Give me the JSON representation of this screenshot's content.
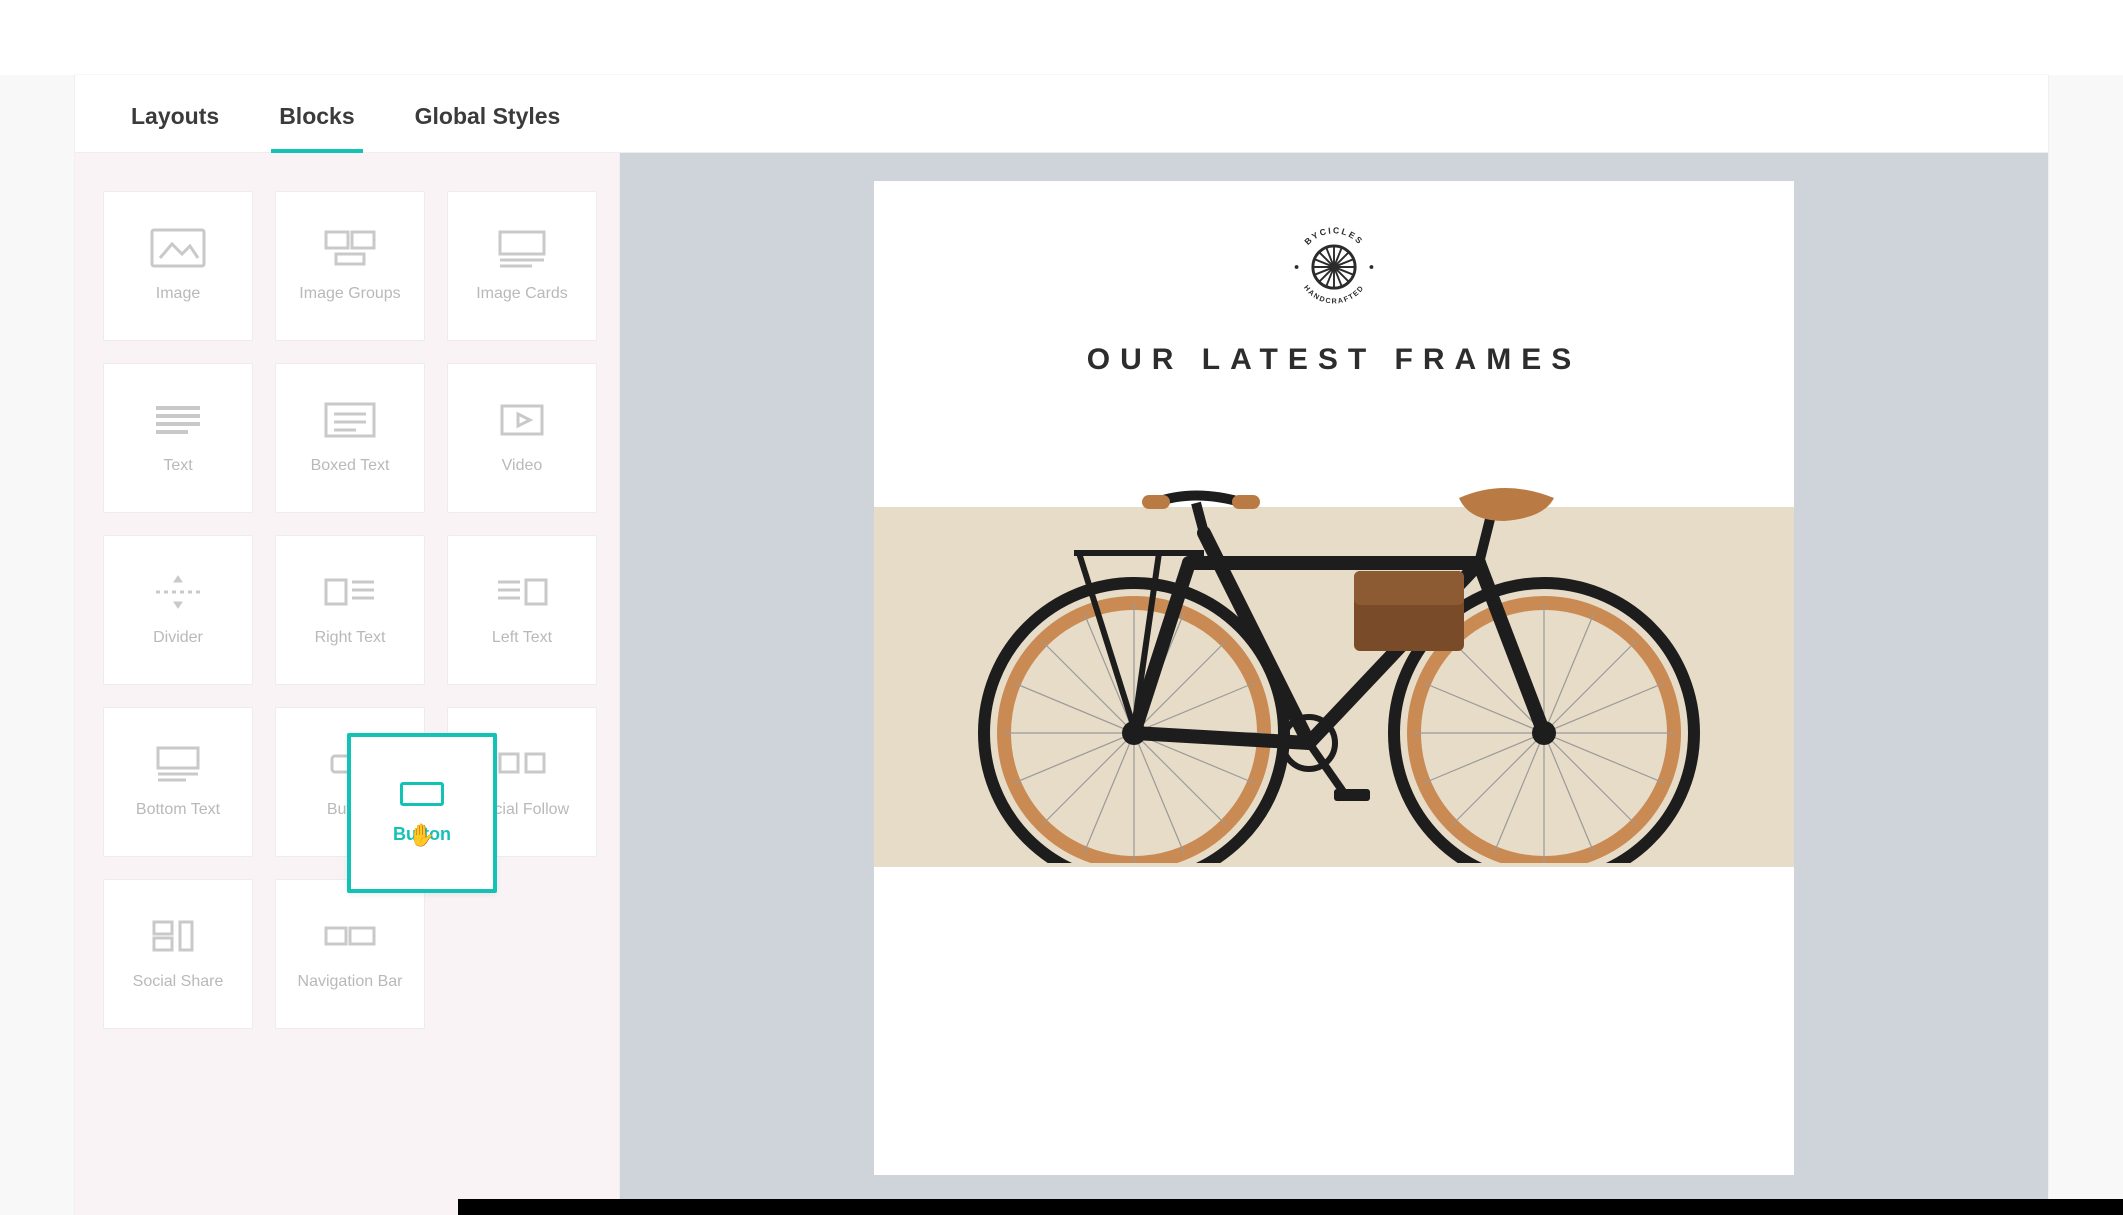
{
  "tabs": {
    "layouts": "Layouts",
    "blocks": "Blocks",
    "global_styles": "Global Styles",
    "active": "blocks"
  },
  "blocks": [
    {
      "id": "image",
      "label": "Image"
    },
    {
      "id": "image-groups",
      "label": "Image Groups"
    },
    {
      "id": "image-cards",
      "label": "Image Cards"
    },
    {
      "id": "text",
      "label": "Text"
    },
    {
      "id": "boxed-text",
      "label": "Boxed Text"
    },
    {
      "id": "video",
      "label": "Video"
    },
    {
      "id": "divider",
      "label": "Divider"
    },
    {
      "id": "right-text",
      "label": "Right Text"
    },
    {
      "id": "left-text",
      "label": "Left Text"
    },
    {
      "id": "bottom-text",
      "label": "Bottom Text"
    },
    {
      "id": "button",
      "label": "Button"
    },
    {
      "id": "social-follow",
      "label": "Social Follow"
    },
    {
      "id": "social-share",
      "label": "Social Share"
    },
    {
      "id": "nav-bar",
      "label": "Navigation Bar"
    }
  ],
  "dragging_block": {
    "id": "button",
    "label": "Button"
  },
  "email": {
    "brand_top": "BYCICLES",
    "brand_bottom": "HANDCRAFTED",
    "headline": "OUR LATEST FRAMES"
  },
  "colors": {
    "accent": "#12c2b5",
    "sidebar_bg": "#f9f3f6",
    "canvas_bg": "#cfd4db",
    "hero_bg": "#e7dcc8"
  }
}
